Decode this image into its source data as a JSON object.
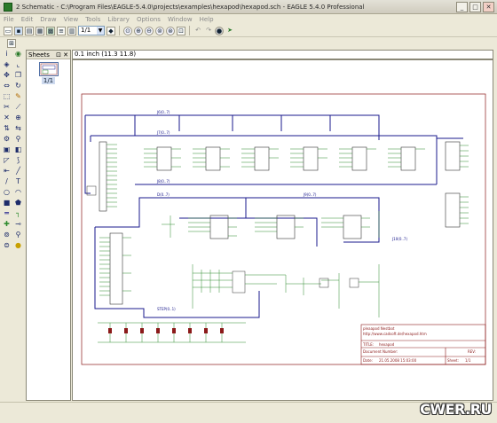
{
  "window": {
    "title": "2 Schematic - C:\\Program Files\\EAGLE-5.4.0\\projects\\examples\\hexapod\\hexapod.sch - EAGLE 5.4.0 Professional",
    "minimize": "_",
    "maximize": "□",
    "close": "✕"
  },
  "menu": [
    "File",
    "Edit",
    "Draw",
    "View",
    "Tools",
    "Library",
    "Options",
    "Window",
    "Help"
  ],
  "toolbar": {
    "sheet_value": "1/1"
  },
  "sheets_panel": {
    "title": "Sheets",
    "pin": "⊡",
    "close": "✕",
    "thumbnail_label": "1/1"
  },
  "coord_readout": "0.1 inch (11.3 11.8)",
  "watermark": "CWER.RU",
  "frame": {
    "company": "pleaapod Nestbot",
    "url": "http://www.cadsoft.de/hexapod.htm",
    "title_label": "TITLE:",
    "title_value": "hexapod",
    "doc_label": "Document Number:",
    "rev_label": "REV:",
    "date_label": "Date:",
    "date_value": "21.05.2008 15:03:00",
    "sheet_label": "Sheet:",
    "sheet_value": "1/1"
  },
  "net_labels": [
    "J6(0..7)",
    "J7(0..7)",
    "J8(0..7)",
    "D(0..7)",
    "J9(0..7)",
    "J10(0..7)",
    "STEP(0..1)"
  ],
  "colors": {
    "net": "#1a1a8c",
    "wire": "#2e8b2e",
    "frame": "#8b1a1a",
    "part": "#333333"
  }
}
